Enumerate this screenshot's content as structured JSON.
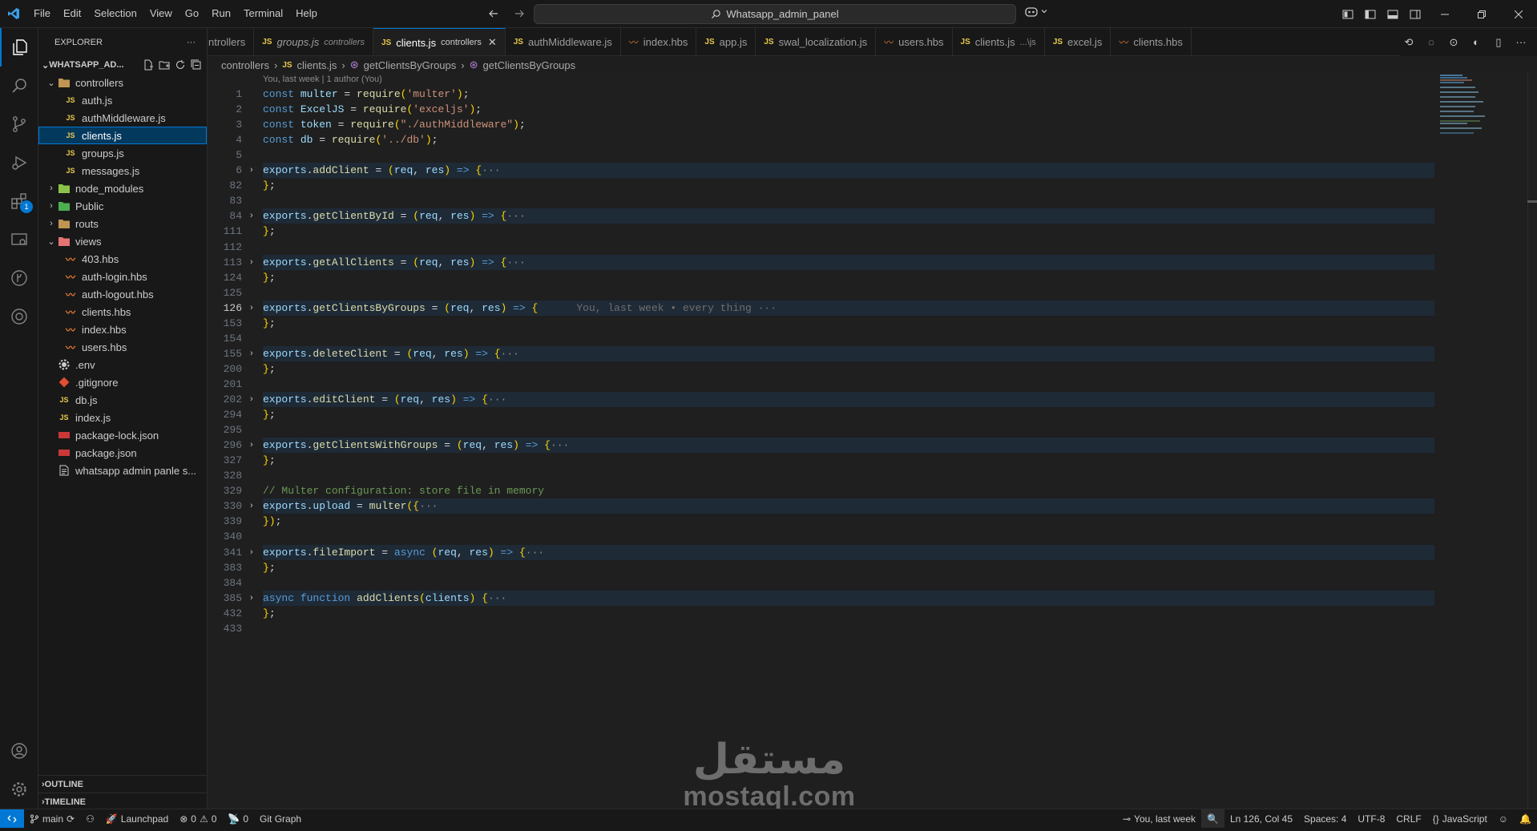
{
  "title_bar": {
    "menus": [
      "File",
      "Edit",
      "Selection",
      "View",
      "Go",
      "Run",
      "Terminal",
      "Help"
    ],
    "search_text": "Whatsapp_admin_panel"
  },
  "activity_bar": {
    "extensions_badge": "1"
  },
  "explorer": {
    "header": "EXPLORER",
    "root": "WHATSAPP_AD...",
    "outline": "OUTLINE",
    "timeline": "TIMELINE",
    "items": [
      {
        "label": "controllers",
        "kind": "folder-open",
        "depth": 1,
        "icon": "folder-icon"
      },
      {
        "label": "auth.js",
        "kind": "js",
        "depth": 2
      },
      {
        "label": "authMiddleware.js",
        "kind": "js",
        "depth": 2
      },
      {
        "label": "clients.js",
        "kind": "js",
        "depth": 2,
        "selected": true
      },
      {
        "label": "groups.js",
        "kind": "js",
        "depth": 2
      },
      {
        "label": "messages.js",
        "kind": "js",
        "depth": 2
      },
      {
        "label": "node_modules",
        "kind": "folder",
        "depth": 1
      },
      {
        "label": "Public",
        "kind": "folder",
        "depth": 1
      },
      {
        "label": "routs",
        "kind": "folder",
        "depth": 1
      },
      {
        "label": "views",
        "kind": "folder-open",
        "depth": 1
      },
      {
        "label": "403.hbs",
        "kind": "hbs",
        "depth": 2
      },
      {
        "label": "auth-login.hbs",
        "kind": "hbs",
        "depth": 2
      },
      {
        "label": "auth-logout.hbs",
        "kind": "hbs",
        "depth": 2
      },
      {
        "label": "clients.hbs",
        "kind": "hbs",
        "depth": 2
      },
      {
        "label": "index.hbs",
        "kind": "hbs",
        "depth": 2
      },
      {
        "label": "users.hbs",
        "kind": "hbs",
        "depth": 2
      },
      {
        "label": ".env",
        "kind": "env",
        "depth": 1
      },
      {
        "label": ".gitignore",
        "kind": "git",
        "depth": 1
      },
      {
        "label": "db.js",
        "kind": "js",
        "depth": 1
      },
      {
        "label": "index.js",
        "kind": "js",
        "depth": 1
      },
      {
        "label": "package-lock.json",
        "kind": "json",
        "depth": 1
      },
      {
        "label": "package.json",
        "kind": "json",
        "depth": 1
      },
      {
        "label": "whatsapp admin panle s...",
        "kind": "doc",
        "depth": 1
      }
    ]
  },
  "tabs": [
    {
      "label": "ntrollers",
      "kind": "none",
      "desc": ""
    },
    {
      "label": "groups.js",
      "kind": "js",
      "desc": "controllers",
      "italic": true
    },
    {
      "label": "clients.js",
      "kind": "js",
      "desc": "controllers",
      "active": true
    },
    {
      "label": "authMiddleware.js",
      "kind": "js",
      "desc": ""
    },
    {
      "label": "index.hbs",
      "kind": "hbs",
      "desc": ""
    },
    {
      "label": "app.js",
      "kind": "js",
      "desc": ""
    },
    {
      "label": "swal_localization.js",
      "kind": "js",
      "desc": ""
    },
    {
      "label": "users.hbs",
      "kind": "hbs",
      "desc": ""
    },
    {
      "label": "clients.js",
      "kind": "js",
      "desc": "...\\js"
    },
    {
      "label": "excel.js",
      "kind": "js",
      "desc": ""
    },
    {
      "label": "clients.hbs",
      "kind": "hbs",
      "desc": ""
    }
  ],
  "breadcrumbs": {
    "folder": "controllers",
    "file": "clients.js",
    "symbol1": "getClientsByGroups",
    "symbol2": "getClientsByGroups"
  },
  "editor": {
    "blame_header": "You, last week | 1 author (You)",
    "inline_blame": "You, last week • every thing",
    "lines": [
      {
        "n": "1",
        "fold": false,
        "hl": false,
        "tokens": [
          [
            "k",
            "const "
          ],
          [
            "v",
            "multer"
          ],
          [
            "p",
            " = "
          ],
          [
            "f",
            "require"
          ],
          [
            "b",
            "("
          ],
          [
            "s",
            "'multer'"
          ],
          [
            "b",
            ")"
          ],
          [
            "p",
            ";"
          ]
        ]
      },
      {
        "n": "2",
        "tokens": [
          [
            "k",
            "const "
          ],
          [
            "v",
            "ExcelJS"
          ],
          [
            "p",
            " = "
          ],
          [
            "f",
            "require"
          ],
          [
            "b",
            "("
          ],
          [
            "s",
            "'exceljs'"
          ],
          [
            "b",
            ")"
          ],
          [
            "p",
            ";"
          ]
        ]
      },
      {
        "n": "3",
        "tokens": [
          [
            "k",
            "const "
          ],
          [
            "v",
            "token"
          ],
          [
            "p",
            " = "
          ],
          [
            "f",
            "require"
          ],
          [
            "b",
            "("
          ],
          [
            "s",
            "\"./authMiddleware\""
          ],
          [
            "b",
            ")"
          ],
          [
            "p",
            ";"
          ]
        ]
      },
      {
        "n": "4",
        "tokens": [
          [
            "k",
            "const "
          ],
          [
            "v",
            "db"
          ],
          [
            "p",
            " = "
          ],
          [
            "f",
            "require"
          ],
          [
            "b",
            "("
          ],
          [
            "s",
            "'../db'"
          ],
          [
            "b",
            ")"
          ],
          [
            "p",
            ";"
          ]
        ]
      },
      {
        "n": "5",
        "tokens": []
      },
      {
        "n": "6",
        "fold": true,
        "hl": true,
        "tokens": [
          [
            "v",
            "exports"
          ],
          [
            "p",
            "."
          ],
          [
            "f",
            "addClient"
          ],
          [
            "p",
            " = "
          ],
          [
            "b",
            "("
          ],
          [
            "v",
            "req"
          ],
          [
            "p",
            ", "
          ],
          [
            "v",
            "res"
          ],
          [
            "b",
            ")"
          ],
          [
            "p",
            " "
          ],
          [
            "k",
            "=>"
          ],
          [
            "p",
            " "
          ],
          [
            "b",
            "{"
          ],
          [
            "fold-dots",
            "···"
          ]
        ]
      },
      {
        "n": "82",
        "tokens": [
          [
            "b",
            "}"
          ],
          [
            "p",
            ";"
          ]
        ]
      },
      {
        "n": "83",
        "tokens": []
      },
      {
        "n": "84",
        "fold": true,
        "hl": true,
        "tokens": [
          [
            "v",
            "exports"
          ],
          [
            "p",
            "."
          ],
          [
            "f",
            "getClientById"
          ],
          [
            "p",
            " = "
          ],
          [
            "b",
            "("
          ],
          [
            "v",
            "req"
          ],
          [
            "p",
            ", "
          ],
          [
            "v",
            "res"
          ],
          [
            "b",
            ")"
          ],
          [
            "p",
            " "
          ],
          [
            "k",
            "=>"
          ],
          [
            "p",
            " "
          ],
          [
            "b",
            "{"
          ],
          [
            "fold-dots",
            "···"
          ]
        ]
      },
      {
        "n": "111",
        "tokens": [
          [
            "b",
            "}"
          ],
          [
            "p",
            ";"
          ]
        ]
      },
      {
        "n": "112",
        "tokens": []
      },
      {
        "n": "113",
        "fold": true,
        "hl": true,
        "tokens": [
          [
            "v",
            "exports"
          ],
          [
            "p",
            "."
          ],
          [
            "f",
            "getAllClients"
          ],
          [
            "p",
            " = "
          ],
          [
            "b",
            "("
          ],
          [
            "v",
            "req"
          ],
          [
            "p",
            ", "
          ],
          [
            "v",
            "res"
          ],
          [
            "b",
            ")"
          ],
          [
            "p",
            " "
          ],
          [
            "k",
            "=>"
          ],
          [
            "p",
            " "
          ],
          [
            "b",
            "{"
          ],
          [
            "fold-dots",
            "···"
          ]
        ]
      },
      {
        "n": "124",
        "tokens": [
          [
            "b",
            "}"
          ],
          [
            "p",
            ";"
          ]
        ]
      },
      {
        "n": "125",
        "tokens": []
      },
      {
        "n": "126",
        "cur": true,
        "fold": true,
        "hl": true,
        "blame": true,
        "tokens": [
          [
            "v",
            "exports"
          ],
          [
            "p",
            "."
          ],
          [
            "f",
            "getClientsByGroups"
          ],
          [
            "p",
            " = "
          ],
          [
            "b",
            "("
          ],
          [
            "v",
            "req"
          ],
          [
            "p",
            ", "
          ],
          [
            "v",
            "res"
          ],
          [
            "b",
            ")"
          ],
          [
            "p",
            " "
          ],
          [
            "k",
            "=>"
          ],
          [
            "p",
            " "
          ],
          [
            "b",
            "{"
          ]
        ]
      },
      {
        "n": "153",
        "tokens": [
          [
            "b",
            "}"
          ],
          [
            "p",
            ";"
          ]
        ]
      },
      {
        "n": "154",
        "tokens": []
      },
      {
        "n": "155",
        "fold": true,
        "hl": true,
        "tokens": [
          [
            "v",
            "exports"
          ],
          [
            "p",
            "."
          ],
          [
            "f",
            "deleteClient"
          ],
          [
            "p",
            " = "
          ],
          [
            "b",
            "("
          ],
          [
            "v",
            "req"
          ],
          [
            "p",
            ", "
          ],
          [
            "v",
            "res"
          ],
          [
            "b",
            ")"
          ],
          [
            "p",
            " "
          ],
          [
            "k",
            "=>"
          ],
          [
            "p",
            " "
          ],
          [
            "b",
            "{"
          ],
          [
            "fold-dots",
            "···"
          ]
        ]
      },
      {
        "n": "200",
        "tokens": [
          [
            "b",
            "}"
          ],
          [
            "p",
            ";"
          ]
        ]
      },
      {
        "n": "201",
        "tokens": []
      },
      {
        "n": "202",
        "fold": true,
        "hl": true,
        "tokens": [
          [
            "v",
            "exports"
          ],
          [
            "p",
            "."
          ],
          [
            "f",
            "editClient"
          ],
          [
            "p",
            " = "
          ],
          [
            "b",
            "("
          ],
          [
            "v",
            "req"
          ],
          [
            "p",
            ", "
          ],
          [
            "v",
            "res"
          ],
          [
            "b",
            ")"
          ],
          [
            "p",
            " "
          ],
          [
            "k",
            "=>"
          ],
          [
            "p",
            " "
          ],
          [
            "b",
            "{"
          ],
          [
            "fold-dots",
            "···"
          ]
        ]
      },
      {
        "n": "294",
        "tokens": [
          [
            "b",
            "}"
          ],
          [
            "p",
            ";"
          ]
        ]
      },
      {
        "n": "295",
        "tokens": []
      },
      {
        "n": "296",
        "fold": true,
        "hl": true,
        "tokens": [
          [
            "v",
            "exports"
          ],
          [
            "p",
            "."
          ],
          [
            "f",
            "getClientsWithGroups"
          ],
          [
            "p",
            " = "
          ],
          [
            "b",
            "("
          ],
          [
            "v",
            "req"
          ],
          [
            "p",
            ", "
          ],
          [
            "v",
            "res"
          ],
          [
            "b",
            ")"
          ],
          [
            "p",
            " "
          ],
          [
            "k",
            "=>"
          ],
          [
            "p",
            " "
          ],
          [
            "b",
            "{"
          ],
          [
            "fold-dots",
            "···"
          ]
        ]
      },
      {
        "n": "327",
        "tokens": [
          [
            "b",
            "}"
          ],
          [
            "p",
            ";"
          ]
        ]
      },
      {
        "n": "328",
        "tokens": []
      },
      {
        "n": "329",
        "tokens": [
          [
            "c",
            "// Multer configuration: store file in memory"
          ]
        ]
      },
      {
        "n": "330",
        "fold": true,
        "hl": true,
        "tokens": [
          [
            "v",
            "exports"
          ],
          [
            "p",
            "."
          ],
          [
            "v",
            "upload"
          ],
          [
            "p",
            " = "
          ],
          [
            "f",
            "multer"
          ],
          [
            "b",
            "({"
          ],
          [
            "fold-dots",
            "···"
          ]
        ]
      },
      {
        "n": "339",
        "tokens": [
          [
            "b",
            "})"
          ],
          [
            "p",
            ";"
          ]
        ]
      },
      {
        "n": "340",
        "tokens": []
      },
      {
        "n": "341",
        "fold": true,
        "hl": true,
        "tokens": [
          [
            "v",
            "exports"
          ],
          [
            "p",
            "."
          ],
          [
            "f",
            "fileImport"
          ],
          [
            "p",
            " = "
          ],
          [
            "k",
            "async"
          ],
          [
            "p",
            " "
          ],
          [
            "b",
            "("
          ],
          [
            "v",
            "req"
          ],
          [
            "p",
            ", "
          ],
          [
            "v",
            "res"
          ],
          [
            "b",
            ")"
          ],
          [
            "p",
            " "
          ],
          [
            "k",
            "=>"
          ],
          [
            "p",
            " "
          ],
          [
            "b",
            "{"
          ],
          [
            "fold-dots",
            "···"
          ]
        ]
      },
      {
        "n": "383",
        "tokens": [
          [
            "b",
            "}"
          ],
          [
            "p",
            ";"
          ]
        ]
      },
      {
        "n": "384",
        "tokens": []
      },
      {
        "n": "385",
        "fold": true,
        "hl": true,
        "tokens": [
          [
            "k",
            "async"
          ],
          [
            "p",
            " "
          ],
          [
            "k",
            "function"
          ],
          [
            "p",
            " "
          ],
          [
            "f",
            "addClients"
          ],
          [
            "b",
            "("
          ],
          [
            "v",
            "clients"
          ],
          [
            "b",
            ")"
          ],
          [
            "p",
            " "
          ],
          [
            "b",
            "{"
          ],
          [
            "fold-dots",
            "···"
          ]
        ]
      },
      {
        "n": "432",
        "tokens": [
          [
            "b",
            "}"
          ],
          [
            "p",
            ";"
          ]
        ]
      },
      {
        "n": "433",
        "tokens": []
      }
    ]
  },
  "watermark": {
    "arabic": "مستقل",
    "latin": "mostaql.com"
  },
  "status_bar": {
    "branch": "main",
    "launchpad": "Launchpad",
    "errors": "0",
    "warnings": "0",
    "ports": "0",
    "git_graph": "Git Graph",
    "blame": "You, last week",
    "position": "Ln 126, Col 45",
    "spaces": "Spaces: 4",
    "encoding": "UTF-8",
    "eol": "CRLF",
    "language": "JavaScript"
  },
  "colors": {
    "accent": "#0078d4",
    "js": "#e8c94d",
    "hbs": "#e37933",
    "json": "#cb3837"
  }
}
